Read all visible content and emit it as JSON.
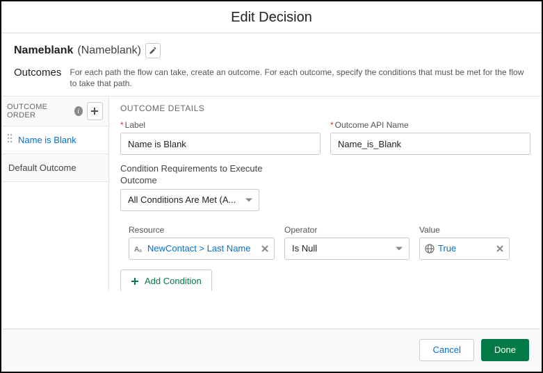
{
  "header": {
    "title": "Edit Decision"
  },
  "decision": {
    "label": "Nameblank",
    "api": "(Nameblank)"
  },
  "outcomes_section": {
    "label": "Outcomes",
    "desc": "For each path the flow can take, create an outcome. For each outcome, specify the conditions that must be met for the flow to take that path."
  },
  "sidebar": {
    "order_label": "OUTCOME ORDER",
    "items": [
      {
        "name": "Name is Blank"
      }
    ],
    "default_label": "Default Outcome"
  },
  "details": {
    "heading": "OUTCOME DETAILS",
    "label_field": {
      "label": "Label",
      "value": "Name is Blank"
    },
    "api_field": {
      "label": "Outcome API Name",
      "value": "Name_is_Blank"
    },
    "condition_req": {
      "label": "Condition Requirements to Execute Outcome",
      "value": "All Conditions Are Met (A..."
    },
    "conditions": [
      {
        "resource_label": "Resource",
        "resource_value": "NewContact > Last Name",
        "operator_label": "Operator",
        "operator_value": "Is Null",
        "value_label": "Value",
        "value_value": "True"
      }
    ],
    "add_condition_label": "Add Condition"
  },
  "footer": {
    "cancel": "Cancel",
    "done": "Done"
  }
}
